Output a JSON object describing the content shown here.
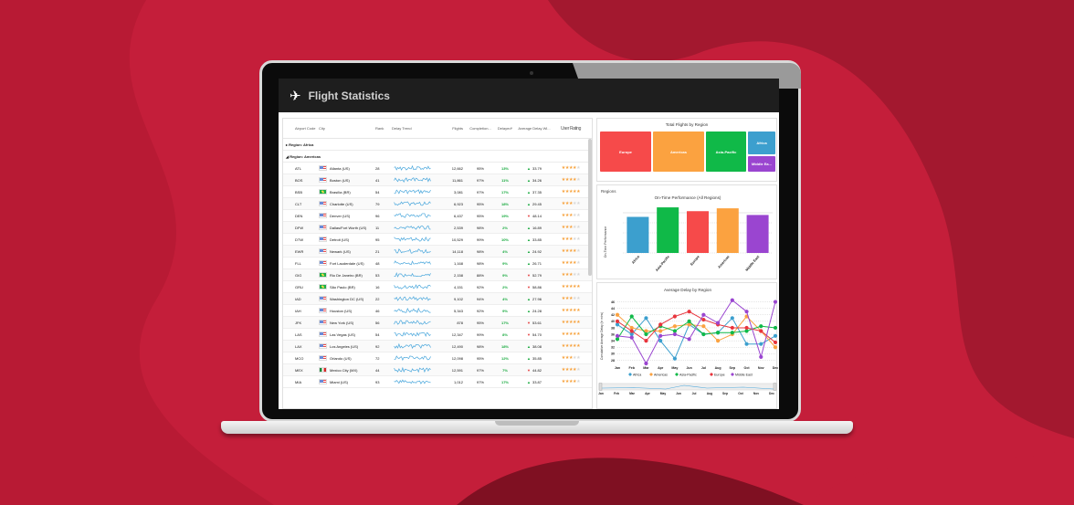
{
  "app": {
    "title": "Flight Statistics",
    "logo_icon": "airplane-icon"
  },
  "grid": {
    "columns": [
      "Airport Code",
      "City",
      "Rank",
      "Delay Trend",
      "Flights",
      "Completion...",
      "Delayed*",
      "Average Delay Wi...",
      "User Rating"
    ],
    "groups": [
      {
        "label": "Region: Africa",
        "expanded": false
      },
      {
        "label": "Region: Americas",
        "expanded": true
      }
    ],
    "rows": [
      {
        "code": "ATL",
        "flag": "us",
        "city": "Atlanta (US)",
        "rank": "28",
        "flights": "12,662",
        "completion": "95%",
        "delayed": "13%",
        "avg_dir": "up",
        "avg": "33.79",
        "rating": 4
      },
      {
        "code": "BOS",
        "flag": "us",
        "city": "Boston (US)",
        "rank": "41",
        "flights": "11,861",
        "completion": "97%",
        "delayed": "11%",
        "avg_dir": "up",
        "avg": "34.26",
        "rating": 4
      },
      {
        "code": "BSB",
        "flag": "br",
        "city": "Brasília (BR)",
        "rank": "54",
        "flights": "3,081",
        "completion": "97%",
        "delayed": "17%",
        "avg_dir": "up",
        "avg": "37.35",
        "rating": 5
      },
      {
        "code": "CLT",
        "flag": "us",
        "city": "Charlotte (US)",
        "rank": "79",
        "flights": "6,923",
        "completion": "95%",
        "delayed": "18%",
        "avg_dir": "up",
        "avg": "29.45",
        "rating": 3
      },
      {
        "code": "DEN",
        "flag": "us",
        "city": "Denver (US)",
        "rank": "96",
        "flights": "6,437",
        "completion": "95%",
        "delayed": "19%",
        "avg_dir": "down",
        "avg": "48.14",
        "rating": 3
      },
      {
        "code": "DFW",
        "flag": "us",
        "city": "Dallas/Fort Worth (US)",
        "rank": "11",
        "flights": "2,539",
        "completion": "98%",
        "delayed": "2%",
        "avg_dir": "up",
        "avg": "16.89",
        "rating": 3
      },
      {
        "code": "DTW",
        "flag": "us",
        "city": "Detroit (US)",
        "rank": "95",
        "flights": "10,529",
        "completion": "99%",
        "delayed": "10%",
        "avg_dir": "up",
        "avg": "33.85",
        "rating": 3
      },
      {
        "code": "EWR",
        "flag": "us",
        "city": "Newark (US)",
        "rank": "21",
        "flights": "14,118",
        "completion": "98%",
        "delayed": "4%",
        "avg_dir": "up",
        "avg": "24.92",
        "rating": 4
      },
      {
        "code": "FLL",
        "flag": "us",
        "city": "Fort Lauderdale (US)",
        "rank": "48",
        "flights": "1,168",
        "completion": "98%",
        "delayed": "9%",
        "avg_dir": "up",
        "avg": "26.71",
        "rating": 4
      },
      {
        "code": "GIG",
        "flag": "br",
        "city": "Rio De Janeiro (BR)",
        "rank": "53",
        "flights": "2,158",
        "completion": "88%",
        "delayed": "9%",
        "avg_dir": "down",
        "avg": "52.79",
        "rating": 3
      },
      {
        "code": "GRU",
        "flag": "br",
        "city": "São Paulo (BR)",
        "rank": "16",
        "flights": "4,151",
        "completion": "92%",
        "delayed": "2%",
        "avg_dir": "down",
        "avg": "58.86",
        "rating": 5
      },
      {
        "code": "IAD",
        "flag": "us",
        "city": "Washington DC (US)",
        "rank": "22",
        "flights": "9,102",
        "completion": "94%",
        "delayed": "4%",
        "avg_dir": "up",
        "avg": "27.96",
        "rating": 3
      },
      {
        "code": "IAH",
        "flag": "us",
        "city": "Houston (US)",
        "rank": "46",
        "flights": "5,343",
        "completion": "92%",
        "delayed": "9%",
        "avg_dir": "up",
        "avg": "24.28",
        "rating": 5
      },
      {
        "code": "JFK",
        "flag": "us",
        "city": "New York (US)",
        "rank": "56",
        "flights": "878",
        "completion": "95%",
        "delayed": "17%",
        "avg_dir": "down",
        "avg": "53.61",
        "rating": 5
      },
      {
        "code": "LAS",
        "flag": "us",
        "city": "Las Vegas (US)",
        "rank": "54",
        "flights": "12,347",
        "completion": "99%",
        "delayed": "8%",
        "avg_dir": "down",
        "avg": "54.70",
        "rating": 5
      },
      {
        "code": "LAX",
        "flag": "us",
        "city": "Los Angeles (US)",
        "rank": "92",
        "flights": "12,490",
        "completion": "98%",
        "delayed": "18%",
        "avg_dir": "up",
        "avg": "38.08",
        "rating": 5
      },
      {
        "code": "MCO",
        "flag": "us",
        "city": "Orlando (US)",
        "rank": "72",
        "flights": "12,098",
        "completion": "95%",
        "delayed": "12%",
        "avg_dir": "up",
        "avg": "35.85",
        "rating": 3
      },
      {
        "code": "MEX",
        "flag": "mx",
        "city": "Mexico City (MX)",
        "rank": "44",
        "flights": "12,591",
        "completion": "97%",
        "delayed": "7%",
        "avg_dir": "down",
        "avg": "44.82",
        "rating": 4
      },
      {
        "code": "MIA",
        "flag": "us",
        "city": "Miami (US)",
        "rank": "93",
        "flights": "1,012",
        "completion": "97%",
        "delayed": "17%",
        "avg_dir": "up",
        "avg": "33.87",
        "rating": 4
      }
    ]
  },
  "treemap": {
    "title": "Total Flights by Region",
    "items": [
      {
        "label": "Europe",
        "color": "#f64a4a"
      },
      {
        "label": "Americas",
        "color": "#fba240"
      },
      {
        "label": "Asia-Pacific",
        "color": "#10b948"
      },
      {
        "label": "Africa",
        "color": "#3c9fce"
      },
      {
        "label": "Middle Ea...",
        "color": "#9a45d0"
      }
    ]
  },
  "chart_data": [
    {
      "type": "bar",
      "panel_label": "Regions",
      "title": "On-Time Performance (All Regions)",
      "ylabel": "On-Time Performance",
      "categories": [
        "Africa",
        "Asia-Pacific",
        "Europe",
        "Americas",
        "Middle East"
      ],
      "values": [
        88,
        98,
        94,
        97,
        90
      ],
      "colors": [
        "#3c9fce",
        "#10b948",
        "#f64a4a",
        "#fba240",
        "#9a45d0"
      ],
      "ylim": [
        50,
        100
      ],
      "grid": true
    },
    {
      "type": "line",
      "title": "Average Delay by Region",
      "ylabel": "Cumulative Average Delay (in mins)",
      "categories": [
        "Jan",
        "Feb",
        "Mar",
        "Apr",
        "May",
        "Jun",
        "Jul",
        "Aug",
        "Sep",
        "Oct",
        "Nov",
        "Dec"
      ],
      "yticks": [
        28,
        30,
        32,
        34,
        36,
        38,
        40,
        42,
        44,
        46
      ],
      "ylim": [
        27,
        47
      ],
      "legend": "bottom",
      "series": [
        {
          "name": "Africa",
          "color": "#3c9fce",
          "values": [
            39,
            36,
            41,
            34,
            28.5,
            39,
            36,
            36.5,
            41,
            33,
            33,
            35.5
          ]
        },
        {
          "name": "Americas",
          "color": "#fba240",
          "values": [
            42,
            38,
            37,
            37,
            38.5,
            39,
            38.5,
            34,
            36,
            41.5,
            37,
            32
          ]
        },
        {
          "name": "Asia-Pacific",
          "color": "#10b948",
          "values": [
            34.5,
            41.5,
            36,
            38.5,
            37,
            40,
            36,
            36.5,
            36.5,
            37,
            38.5,
            38
          ]
        },
        {
          "name": "Europe",
          "color": "#e8343c",
          "values": [
            40,
            37,
            34,
            39,
            41.5,
            43,
            40.5,
            39,
            38,
            38,
            37,
            33.5
          ]
        },
        {
          "name": "Middle East",
          "color": "#9a45d0",
          "values": [
            35.5,
            35,
            27,
            35.5,
            36,
            34.5,
            42,
            39.5,
            46.5,
            43,
            29,
            46
          ]
        }
      ],
      "navigator_labels": [
        "Jan",
        "Feb",
        "Mar",
        "Apr",
        "May",
        "Jun",
        "Jul",
        "Aug",
        "Sep",
        "Oct",
        "Nov",
        "Dec"
      ]
    }
  ]
}
